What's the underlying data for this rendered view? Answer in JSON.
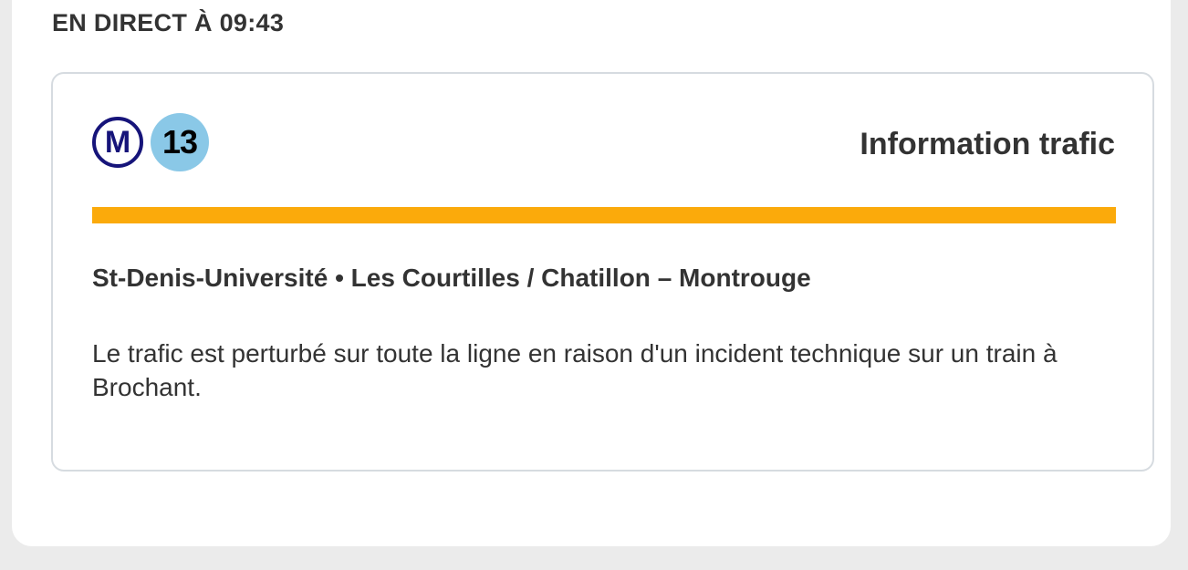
{
  "live": {
    "label": "EN DIRECT À 09:43"
  },
  "traffic_card": {
    "metro_badge": "M",
    "line_number": "13",
    "title": "Information trafic",
    "severity_color": "#fbaa0b",
    "line_color": "#8ac8e7",
    "metro_color": "#16147a",
    "section": "St-Denis-Université • Les Courtilles / Chatillon – Montrouge",
    "message": "Le trafic est perturbé sur toute la ligne en raison d'un incident technique sur un train à Brochant."
  }
}
